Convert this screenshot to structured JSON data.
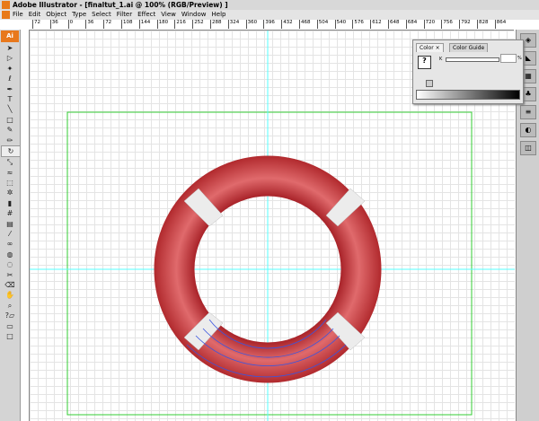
{
  "window": {
    "title": "Adobe Illustrator - [finaltut_1.ai @ 100% (RGB/Preview) ]"
  },
  "menu": [
    "File",
    "Edit",
    "Object",
    "Type",
    "Select",
    "Filter",
    "Effect",
    "View",
    "Window",
    "Help"
  ],
  "ruler": {
    "h": [
      "72",
      "36",
      "0",
      "36",
      "72",
      "108",
      "144",
      "180",
      "216",
      "252",
      "288",
      "324",
      "360",
      "396",
      "432",
      "468",
      "504",
      "540",
      "576",
      "612",
      "648",
      "684",
      "720",
      "756",
      "792",
      "828",
      "864"
    ]
  },
  "toolbar": {
    "logo": "Ai",
    "tools": [
      "selection",
      "direct-selection",
      "magic-wand",
      "lasso",
      "pen",
      "type",
      "line",
      "rectangle",
      "paintbrush",
      "pencil",
      "rotate",
      "scale",
      "warp",
      "free-transform",
      "symbol-sprayer",
      "column-graph",
      "mesh",
      "gradient",
      "eyedropper",
      "blend",
      "live-paint",
      "live-paint-selection",
      "slice",
      "eraser",
      "hand",
      "zoom"
    ]
  },
  "color_panel": {
    "tabs": [
      "Color",
      "Color Guide"
    ],
    "channel_label": "K",
    "percent": "%",
    "value": ""
  },
  "colors": {
    "ring": "#c8363a",
    "guide": "#5ff",
    "artboard": "#3c3",
    "selection": "#3a55e0"
  }
}
